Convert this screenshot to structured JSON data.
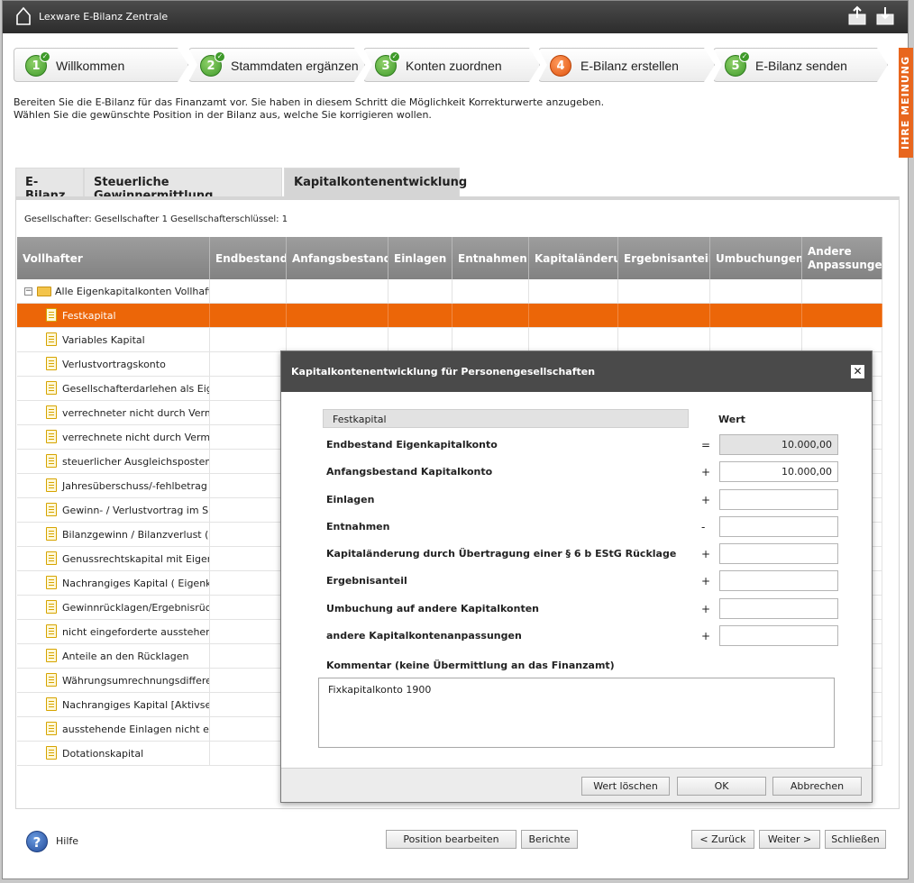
{
  "app": {
    "title": "Lexware E-Bilanz Zentrale",
    "feedback_label": "IHRE MEINUNG"
  },
  "steps": [
    {
      "num": "1",
      "label": "Willkommen",
      "status": "done"
    },
    {
      "num": "2",
      "label": "Stammdaten ergänzen",
      "status": "done"
    },
    {
      "num": "3",
      "label": "Konten zuordnen",
      "status": "done"
    },
    {
      "num": "4",
      "label": "E-Bilanz erstellen",
      "status": "current"
    },
    {
      "num": "5",
      "label": "E-Bilanz senden",
      "status": "done"
    }
  ],
  "intro": {
    "line1": "Bereiten Sie die E-Bilanz für das Finanzamt vor. Sie haben in diesem Schritt die Möglichkeit Korrekturwerte anzugeben.",
    "line2": "Wählen Sie die gewünschte Position in der Bilanz aus, welche Sie korrigieren wollen."
  },
  "tabs": [
    {
      "label": "E-Bilanz"
    },
    {
      "label": "Steuerliche Gewinnermittlung"
    },
    {
      "label": "Kapitalkontenentwicklung"
    }
  ],
  "gesellschafter_info": "Gesellschafter:  Gesellschafter 1  Gesellschafterschlüssel:  1",
  "grid": {
    "columns": [
      "Vollhafter",
      "Endbestand",
      "Anfangsbestand",
      "Einlagen",
      "Entnahmen",
      "Kapitaländerung",
      "Ergebnisanteil",
      "Umbuchungen",
      "Andere Anpassungen"
    ],
    "root": "Alle Eigenkapitalkonten Vollhafter",
    "rows": [
      "Festkapital",
      "Variables Kapital",
      "Verlustvortragskonto",
      "Gesellschafterdarlehen als Eigenkapital",
      "verrechneter nicht durch Vermögenseinlagen",
      "verrechnete nicht durch Vermögenseinlagen",
      "steuerlicher Ausgleichsposten",
      "Jahresüberschuss/-fehlbetrag (Bilanz)",
      "Gewinn- / Verlustvortrag im Sinne",
      "Bilanzgewinn / Bilanzverlust (Bilanz)",
      "Genussrechtskapital mit Eigenkapital",
      "Nachrangiges Kapital ( Eigenkapital",
      "Gewinnrücklagen/Ergebnisrücklagen",
      "nicht eingeforderte ausstehende Einlagen",
      "Anteile an den Rücklagen",
      "Währungsumrechnungsdifferenzen",
      "Nachrangiges Kapital [Aktivseite]",
      "ausstehende Einlagen nicht eingefordert",
      "Dotationskapital"
    ],
    "selected_index": 0
  },
  "modal": {
    "title": "Kapitalkontenentwicklung für Personengesellschaften",
    "position": "Festkapital",
    "wert_header": "Wert",
    "fields": [
      {
        "label": "Endbestand Eigenkapitalkonto",
        "op": "=",
        "value": "10.000,00",
        "readonly": true
      },
      {
        "label": "Anfangsbestand Kapitalkonto",
        "op": "+",
        "value": "10.000,00",
        "readonly": false
      },
      {
        "label": "Einlagen",
        "op": "+",
        "value": "",
        "readonly": false
      },
      {
        "label": "Entnahmen",
        "op": "-",
        "value": "",
        "readonly": false
      },
      {
        "label": "Kapitaländerung durch Übertragung einer § 6 b EStG Rücklage",
        "op": "+",
        "value": "",
        "readonly": false
      },
      {
        "label": "Ergebnisanteil",
        "op": "+",
        "value": "",
        "readonly": false
      },
      {
        "label": "Umbuchung auf andere Kapitalkonten",
        "op": "+",
        "value": "",
        "readonly": false
      },
      {
        "label": "andere Kapitalkontenanpassungen",
        "op": "+",
        "value": "",
        "readonly": false
      }
    ],
    "comment_label": "Kommentar (keine Übermittlung an das Finanzamt)",
    "comment_value": "Fixkapitalkonto 1900",
    "buttons": {
      "clear": "Wert löschen",
      "ok": "OK",
      "cancel": "Abbrechen"
    }
  },
  "footer": {
    "help": "Hilfe",
    "edit_position": "Position bearbeiten",
    "reports": "Berichte",
    "back": "< Zurück",
    "next": "Weiter >",
    "close": "Schließen"
  },
  "colors": {
    "accent": "#ec6608",
    "titlebar": "#3a3a3a",
    "grid_header": "#8e8e8e",
    "step_done": "#3f9a2a"
  }
}
